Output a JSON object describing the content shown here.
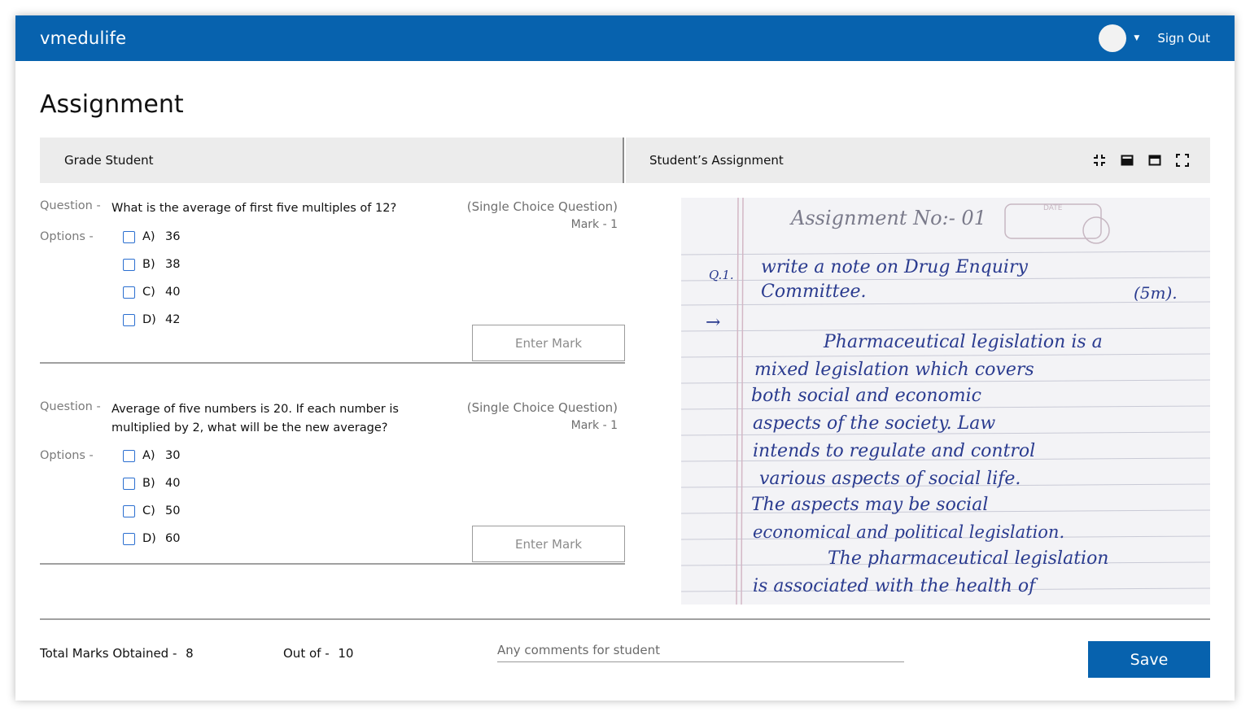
{
  "header": {
    "brand": "vmedulife",
    "sign_out": "Sign Out"
  },
  "page": {
    "title": "Assignment"
  },
  "panels": {
    "left_title": "Grade Student",
    "right_title": "Student’s Assignment"
  },
  "labels": {
    "question": "Question -",
    "options": "Options -",
    "mark_placeholder": "Enter Mark"
  },
  "questions": [
    {
      "text": "What is the average of first five multiples of 12?",
      "type": "(Single Choice Question)",
      "mark": "Mark - 1",
      "options": [
        {
          "letter": "A)",
          "value": "36"
        },
        {
          "letter": "B)",
          "value": "38"
        },
        {
          "letter": "C)",
          "value": "40"
        },
        {
          "letter": "D)",
          "value": "42"
        }
      ]
    },
    {
      "text": "Average of five numbers is 20. If each number is multiplied by 2, what will be the new average?",
      "type": "(Single Choice Question)",
      "mark": "Mark - 1",
      "options": [
        {
          "letter": "A)",
          "value": "30"
        },
        {
          "letter": "B)",
          "value": "40"
        },
        {
          "letter": "C)",
          "value": "50"
        },
        {
          "letter": "D)",
          "value": "60"
        }
      ]
    }
  ],
  "assignment": {
    "heading": "Assignment No:- 01",
    "date_label": "DATE",
    "q_marker": "Q.1.",
    "question_line1": "write a note on Drug Enquiry",
    "question_line2": "Committee.",
    "marks": "(5m).",
    "arrow": "→",
    "lines": [
      "Pharmaceutical legislation is a",
      "mixed legislation which covers",
      "both social and economic",
      "aspects of the society. Law",
      "intends to regulate and control",
      "various aspects of social life.",
      "The aspects may be social",
      "economical and political legislation.",
      "The pharmaceutical legislation",
      "is associated with the health of"
    ]
  },
  "footer": {
    "total_label": "Total Marks Obtained -",
    "total_value": "8",
    "outof_label": "Out of -",
    "outof_value": "10",
    "comment_placeholder": "Any comments for student",
    "save": "Save"
  },
  "colors": {
    "primary": "#0762ae",
    "panel_bg": "#ececec",
    "checkbox": "#2b6fd0",
    "ink": "#2a3b8f"
  },
  "icons": [
    "chevron-down-icon",
    "collapse-icon",
    "split-bottom-icon",
    "split-top-icon",
    "fullscreen-icon"
  ]
}
